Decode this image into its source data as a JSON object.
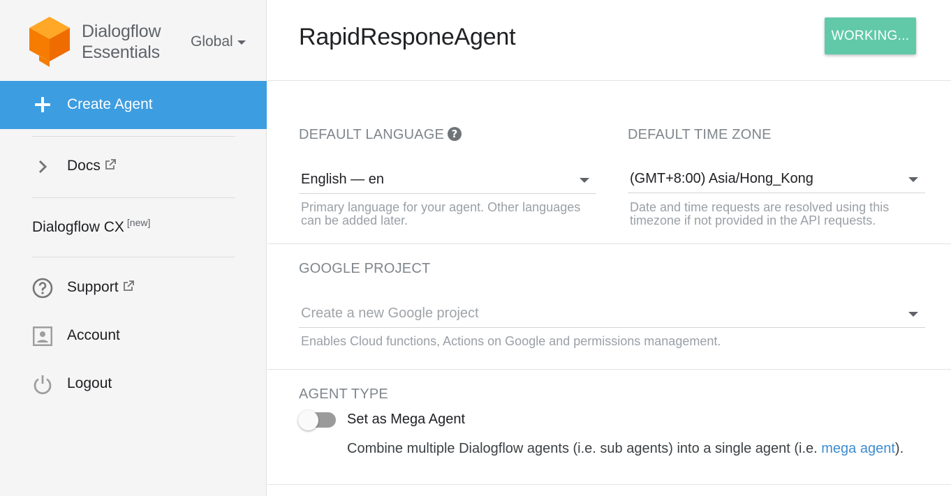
{
  "sidebar": {
    "brand_line1": "Dialogflow",
    "brand_line2": "Essentials",
    "region": "Global",
    "create_agent": "Create Agent",
    "docs": "Docs",
    "dialogflow_cx": "Dialogflow CX",
    "cx_badge": "[new]",
    "support": "Support",
    "account": "Account",
    "logout": "Logout"
  },
  "header": {
    "agent_name": "RapidResponeAgent",
    "status_button": "WORKING..."
  },
  "language": {
    "label": "DEFAULT LANGUAGE",
    "value": "English — en",
    "hint_line1": "Primary language for your agent. Other languages",
    "hint_line2": "can be added later."
  },
  "timezone": {
    "label": "DEFAULT TIME ZONE",
    "value": "(GMT+8:00) Asia/Hong_Kong",
    "hint_line1": "Date and time requests are resolved using this",
    "hint_line2": "timezone if not provided in the API requests."
  },
  "google_project": {
    "label": "GOOGLE PROJECT",
    "placeholder": "Create a new Google project",
    "hint": "Enables Cloud functions, Actions on Google and permissions management."
  },
  "agent_type": {
    "label": "AGENT TYPE",
    "toggle_label": "Set as Mega Agent",
    "toggle_on": false,
    "desc_prefix": "Combine multiple Dialogflow agents (i.e. sub agents) into a single agent (i.e. ",
    "desc_link": "mega agent",
    "desc_suffix": ")."
  },
  "colors": {
    "accent": "#3d9de1",
    "working_button": "#61c9a8",
    "logo_orange": "#f57c00",
    "link": "#3d8cd0"
  },
  "icons": {
    "logo": "dialogflow-cube-icon",
    "create": "plus-icon",
    "docs": "chevron-right-icon",
    "support": "help-circle-icon",
    "account": "account-box-icon",
    "logout": "power-icon",
    "external": "external-link-icon",
    "help": "help-icon"
  }
}
